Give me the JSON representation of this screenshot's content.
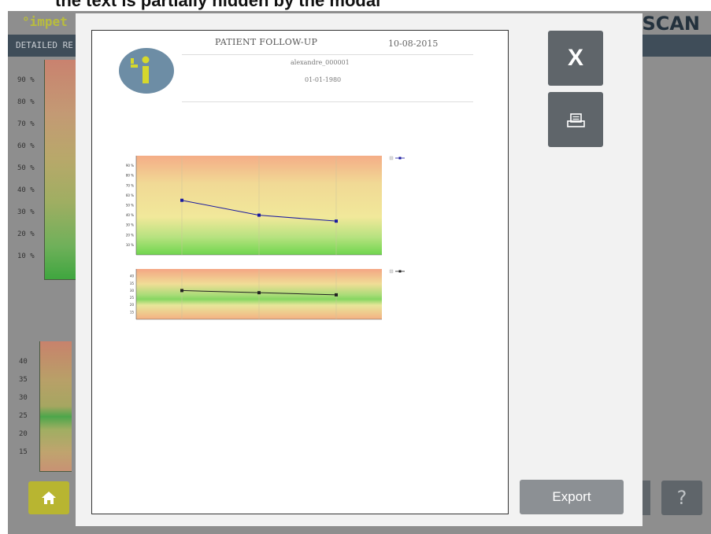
{
  "caption": "the text is partially hidden by the modal",
  "background_app": {
    "logo_text": "°impet",
    "brand_right": "SCAN",
    "sub_bar_label": "DETAILED RE",
    "gauge1_ticks": [
      "90 %",
      "80 %",
      "70 %",
      "60 %",
      "50 %",
      "40 %",
      "30 %",
      "20 %",
      "10 %"
    ],
    "gauge2_ticks": [
      "40",
      "35",
      "30",
      "25",
      "20",
      "15"
    ],
    "help_label": "?",
    "home_icon": "home-icon"
  },
  "modal": {
    "report": {
      "title": "PATIENT FOLLOW-UP",
      "date": "10-08-2015",
      "patient_name": "alexandre_000001",
      "patient_dob": "01-01-1980"
    },
    "buttons": {
      "close_label": "X",
      "print_icon": "printer-icon",
      "export_label": "Export"
    }
  },
  "chart_data": [
    {
      "type": "line",
      "series": [
        {
          "name": "",
          "values": [
            55,
            40,
            34
          ]
        }
      ],
      "categories": [
        "",
        "",
        ""
      ],
      "y_ticks": [
        "90 %",
        "80 %",
        "70 %",
        "60 %",
        "50 %",
        "40 %",
        "30 %",
        "20 %",
        "10 %"
      ],
      "ylim": [
        0,
        100
      ],
      "legend_placement": "right",
      "series_color": "#1a1aa0"
    },
    {
      "type": "line",
      "series": [
        {
          "name": "",
          "values": [
            30,
            28.5,
            27
          ]
        }
      ],
      "categories": [
        "",
        "",
        ""
      ],
      "y_ticks": [
        "40",
        "35",
        "30",
        "25",
        "20",
        "15"
      ],
      "ylim": [
        10,
        45
      ],
      "legend_placement": "right",
      "series_color": "#222222"
    }
  ]
}
